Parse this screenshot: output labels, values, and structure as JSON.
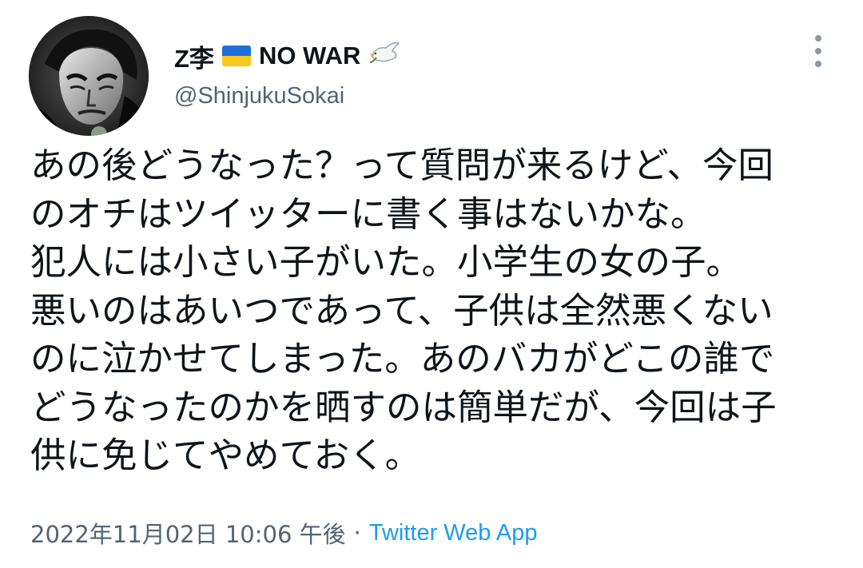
{
  "author": {
    "display_name": "Z李",
    "war_text": "NO WAR",
    "handle": "@ShinjukuSokai",
    "flag_icon": "ukraine-flag-icon",
    "dove_icon": "dove-icon",
    "avatar_icon": "avatar-image"
  },
  "more_icon": "more-options-icon",
  "tweet": {
    "lines": [
      "あの後どうなった？って質問が来るけど、今回",
      "のオチはツイッターに書く事はないかな。",
      "犯人には小さい子がいた。小学生の女の子。",
      "悪いのはあいつであって、子供は全然悪くない",
      "のに泣かせてしまった。あのバカがどこの誰で",
      "どうなったのかを晒すのは簡単だが、今回は子",
      "供に免じてやめておく。"
    ]
  },
  "meta": {
    "timestamp": "2022年11月02日 10:06 午後",
    "separator": "·",
    "source": "Twitter Web App"
  },
  "colors": {
    "text": "#0f1419",
    "secondary": "#536471",
    "link": "#1d9bf0",
    "flag_blue": "#1f6fd6",
    "flag_yellow": "#f7c81a"
  }
}
